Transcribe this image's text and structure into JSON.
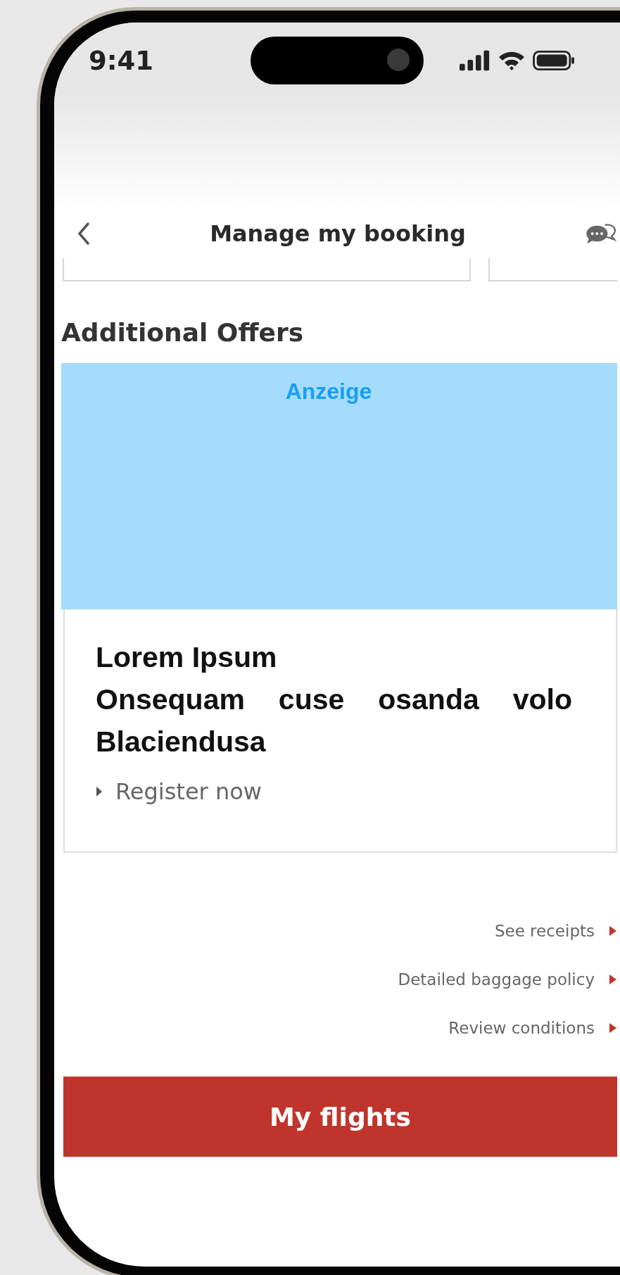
{
  "status_bar": {
    "time": "9:41"
  },
  "header": {
    "title": "Manage my booking"
  },
  "section_title": "Additional Offers",
  "ad": {
    "label": "Anzeige"
  },
  "offer": {
    "title": "Lorem Ipsum",
    "text": "Onsequam cuse osanda volo Blaciendusa",
    "link": "Register now"
  },
  "links": [
    "See receipts",
    "Detailed baggage policy",
    "Review conditions"
  ],
  "primary_button": "My flights"
}
